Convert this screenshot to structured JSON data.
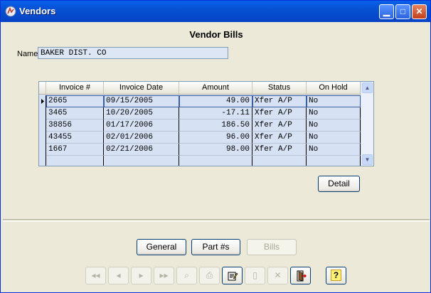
{
  "window": {
    "title": "Vendors"
  },
  "form": {
    "heading": "Vendor Bills",
    "name_label": "Name",
    "name_value": "BAKER DIST. CO"
  },
  "grid": {
    "columns": [
      "Invoice #",
      "Invoice Date",
      "Amount",
      "Status",
      "On Hold"
    ],
    "rows": [
      [
        "2665",
        "09/15/2005",
        "49.00",
        "Xfer A/P",
        "No"
      ],
      [
        "3465",
        "10/20/2005",
        "-17.11",
        "Xfer A/P",
        "No"
      ],
      [
        "38856",
        "01/17/2006",
        "186.50",
        "Xfer A/P",
        "No"
      ],
      [
        "43455",
        "02/01/2006",
        "96.00",
        "Xfer A/P",
        "No"
      ],
      [
        "1667",
        "02/21/2006",
        "98.00",
        "Xfer A/P",
        "No"
      ]
    ],
    "selected_row": 0
  },
  "buttons": {
    "detail": "Detail",
    "general": "General",
    "part": "Part #s",
    "bills": "Bills"
  },
  "toolbar": {
    "help": "?"
  },
  "colors": {
    "titlebar": "#0650D0",
    "grid_bg": "#D6E2F4",
    "window_bg": "#ECE9D8"
  }
}
